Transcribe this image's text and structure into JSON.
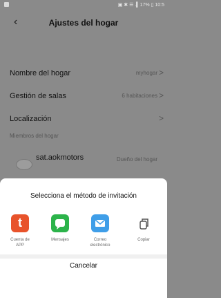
{
  "status": {
    "right": "▣ ✱ ☰ .▍17% ▯ 10:5"
  },
  "header": {
    "title": "Ajustes del hogar",
    "back_icon": "‹"
  },
  "settings": [
    {
      "label": "Nombre del hogar",
      "value": "myhogar",
      "chevron": ">"
    },
    {
      "label": "Gestión de salas",
      "value": "6 habitaciones",
      "chevron": ">"
    },
    {
      "label": "Localización",
      "value": "",
      "chevron": ">"
    }
  ],
  "members": {
    "section_title": "Miembros del hogar",
    "items": [
      {
        "name": "sat.aokmotors",
        "role": "Dueño del hogar",
        "chevron": ">"
      }
    ]
  },
  "sheet": {
    "title": "Selecciona el método de invitación",
    "options": [
      {
        "label": "Cuenta de\nAPP",
        "icon": "app-t-icon",
        "color": "#e8532b"
      },
      {
        "label": "Mensajes",
        "icon": "message-bubble-icon",
        "color": "#2cb34a"
      },
      {
        "label": "Correo\nelectrónico",
        "icon": "mail-envelope-icon",
        "color": "#3f9ee8"
      },
      {
        "label": "Copiar",
        "icon": "copy-icon",
        "color": "#555555"
      }
    ],
    "app_letter": "t",
    "cancel": "Cancelar"
  }
}
